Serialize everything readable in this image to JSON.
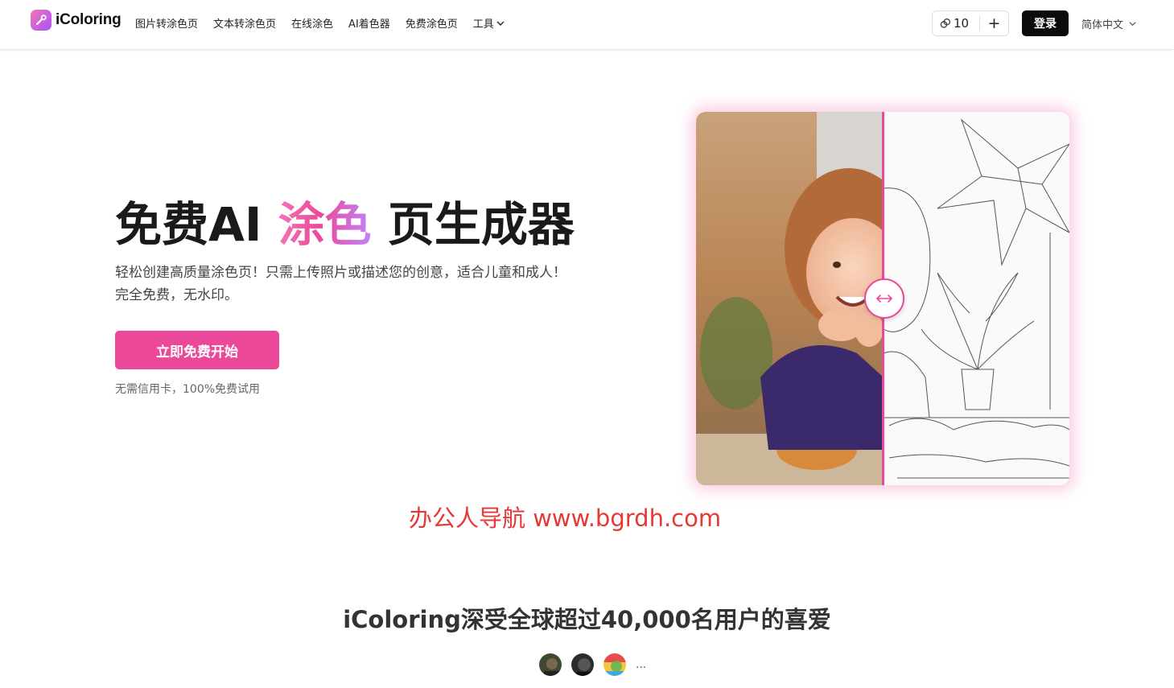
{
  "header": {
    "brand": "iColoring",
    "nav": [
      {
        "label": "图片转涂色页"
      },
      {
        "label": "文本转涂色页"
      },
      {
        "label": "在线涂色"
      },
      {
        "label": "AI着色器"
      },
      {
        "label": "免费涂色页"
      },
      {
        "label": "工具"
      }
    ],
    "credits": "10",
    "add_credits": "+",
    "login": "登录",
    "language": "简体中文"
  },
  "hero": {
    "title_prefix": "免费AI ",
    "title_accent": "涂色",
    "title_suffix": " 页生成器",
    "subtitle": "轻松创建高质量涂色页！只需上传照片或描述您的创意，适合儿童和成人！完全免费，无水印。",
    "cta": "立即免费开始",
    "note": "无需信用卡，100%免费试用",
    "compare_handle_icon": "double-arrow-icon"
  },
  "watermark": "办公人导航 www.bgrdh.com",
  "social_proof": {
    "title": "iColoring深受全球超过40,000名用户的喜爱",
    "more": "..."
  },
  "colors": {
    "accent": "#ec4899",
    "accent_gradient_end": "#c084fc",
    "login_bg": "#0b0b0b",
    "watermark": "#e53935"
  }
}
